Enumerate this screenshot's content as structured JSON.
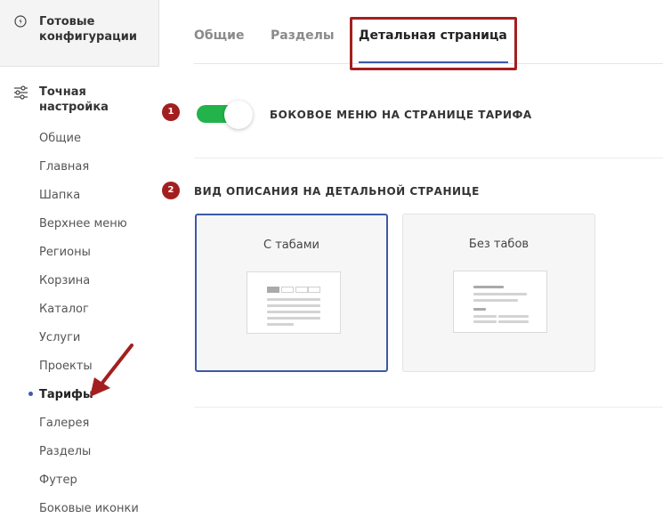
{
  "sidebar": {
    "ready_configs": "Готовые конфигурации",
    "fine_tuning": "Точная настройка",
    "items": [
      {
        "label": "Общие"
      },
      {
        "label": "Главная"
      },
      {
        "label": "Шапка"
      },
      {
        "label": "Верхнее меню"
      },
      {
        "label": "Регионы"
      },
      {
        "label": "Корзина"
      },
      {
        "label": "Каталог"
      },
      {
        "label": "Услуги"
      },
      {
        "label": "Проекты"
      },
      {
        "label": "Тарифы"
      },
      {
        "label": "Галерея"
      },
      {
        "label": "Разделы"
      },
      {
        "label": "Футер"
      },
      {
        "label": "Боковые иконки"
      }
    ],
    "active_item": "Тарифы"
  },
  "tabs": [
    {
      "label": "Общие"
    },
    {
      "label": "Разделы"
    },
    {
      "label": "Детальная страница"
    }
  ],
  "active_tab": "Детальная страница",
  "settings": {
    "side_menu": {
      "badge": "1",
      "label": "БОКОВОЕ МЕНЮ НА СТРАНИЦЕ ТАРИФА",
      "enabled": true
    },
    "description_view": {
      "badge": "2",
      "label": "ВИД ОПИСАНИЯ НА ДЕТАЛЬНОЙ СТРАНИЦЕ",
      "options": [
        {
          "label": "С табами",
          "selected": true
        },
        {
          "label": "Без табов",
          "selected": false
        }
      ]
    }
  },
  "colors": {
    "accent": "#3d59a8",
    "toggle_on": "#22b34a",
    "annotation_red": "#a31f1f"
  }
}
